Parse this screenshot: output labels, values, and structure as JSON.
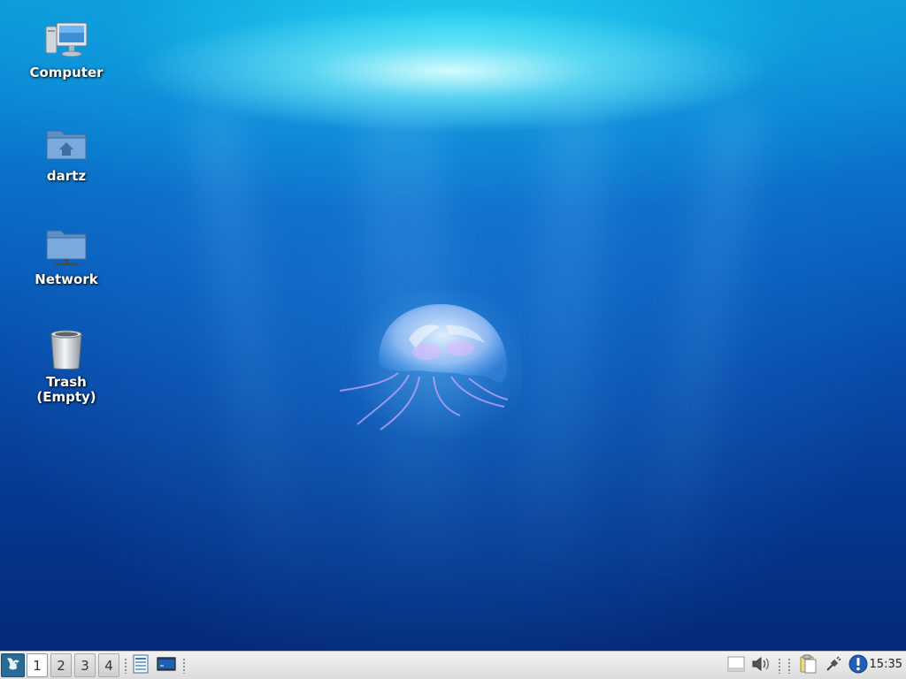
{
  "desktop": {
    "icons": [
      {
        "label": "Computer",
        "icon": "computer-icon"
      },
      {
        "label": "dartz",
        "icon": "home-folder-icon"
      },
      {
        "label": "Network",
        "icon": "network-folder-icon"
      },
      {
        "label": "Trash\n(Empty)",
        "icon": "trash-icon"
      }
    ],
    "wallpaper": "underwater-jellyfish"
  },
  "panel": {
    "menu_icon": "xfce-mouse-icon",
    "workspaces": [
      "1",
      "2",
      "3",
      "4"
    ],
    "active_workspace": "1",
    "launchers": [
      "file-manager-icon",
      "terminal-icon"
    ],
    "tray": [
      "blank-window-icon",
      "volume-icon",
      "clipboard-icon",
      "network-plug-icon",
      "update-notifier-icon"
    ],
    "clock": "15:35"
  },
  "colors": {
    "panel_bg": "#e6e6e6",
    "menu_button": "#2a6b96",
    "notifier": "#1f5fb4"
  }
}
